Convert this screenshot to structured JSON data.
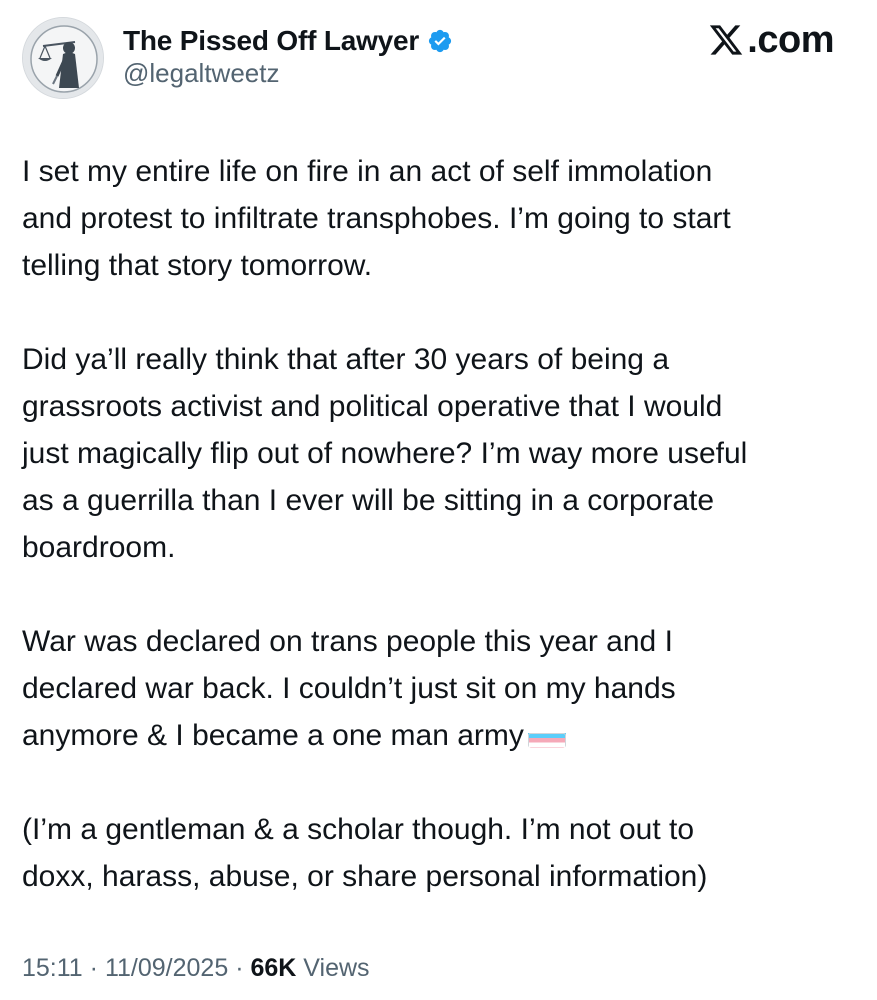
{
  "brand": {
    "logo_icon": "x-logo-icon",
    "text": ".com"
  },
  "author": {
    "display_name": "The Pissed Off Lawyer",
    "handle": "@legaltweetz",
    "verified_icon": "verified-badge-icon",
    "avatar_icon": "lady-justice-icon"
  },
  "tweet": {
    "paragraphs": [
      "I set my entire life on fire in an act of self immolation\nand protest to infiltrate transphobes. I’m going to start\ntelling that story tomorrow.",
      "Did ya’ll really think that after 30 years of being a\ngrassroots activist and political operative that I would\njust magically flip out of nowhere? I’m way more useful\nas a guerrilla than I ever will be sitting in a corporate\nboardroom.",
      "War was declared on trans people this year and I\ndeclared war back. I couldn’t just sit on my hands\nanymore & I became a one man army",
      "(I’m a gentleman & a scholar though. I’m not out to\ndoxx, harass, abuse, or share personal information)"
    ],
    "flag_icon": "transgender-flag-icon"
  },
  "meta": {
    "time": "15:11",
    "separator": "·",
    "date": "11/09/2025",
    "views_count": "66K",
    "views_label": "Views"
  },
  "colors": {
    "text_primary": "#0f1419",
    "text_secondary": "#536471",
    "verified_blue": "#1d9bf0",
    "flag_blue": "#5bcefa",
    "flag_pink": "#f5a9b8",
    "flag_white": "#ffffff"
  }
}
